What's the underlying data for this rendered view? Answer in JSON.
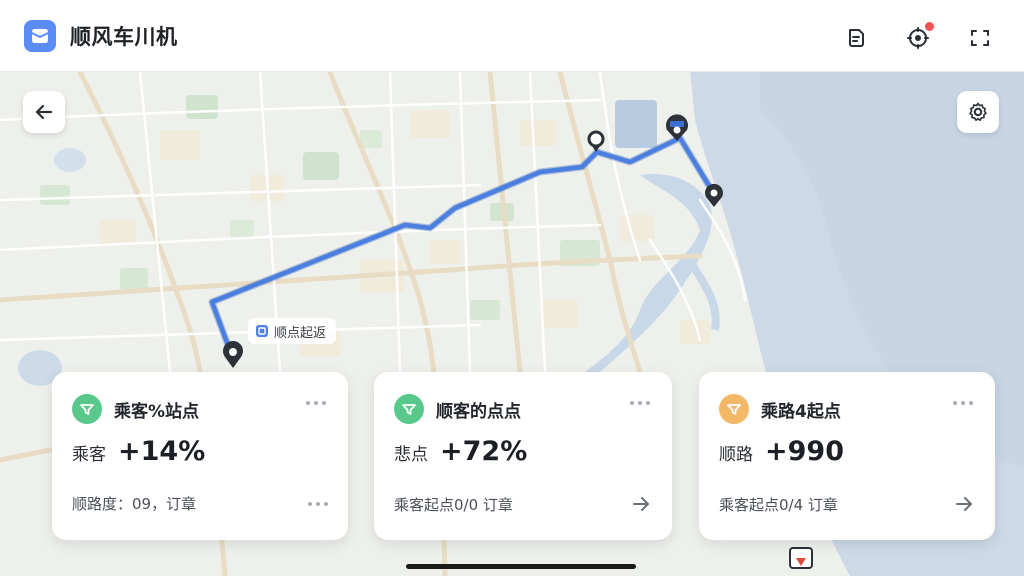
{
  "header": {
    "title": "顺风车川机",
    "icons": [
      "app-logo-icon",
      "document-icon",
      "location-target-icon",
      "scan-icon"
    ],
    "notification_color": "#f0524f"
  },
  "map": {
    "route_color": "#4a7fe0",
    "label": "顺点起返",
    "markers": [
      "start-pin",
      "mid-pin",
      "end-pin-1",
      "end-pin-2"
    ]
  },
  "cards": [
    {
      "title": "乘客%站点",
      "badge_color": "#58c98b",
      "metric_label": "乘客",
      "metric_value": "+14%",
      "footer": "顺路度：09，订章",
      "footer_action": "more"
    },
    {
      "title": "顺客的点点",
      "badge_color": "#58c98b",
      "metric_label": "悲点",
      "metric_value": "+72%",
      "footer": "乘客起点0/0 订章",
      "footer_action": "arrow"
    },
    {
      "title": "乘路4起点",
      "badge_color": "#f3b866",
      "metric_label": "顺路",
      "metric_value": "+990",
      "footer": "乘客起点0/4 订章",
      "footer_action": "arrow"
    }
  ]
}
